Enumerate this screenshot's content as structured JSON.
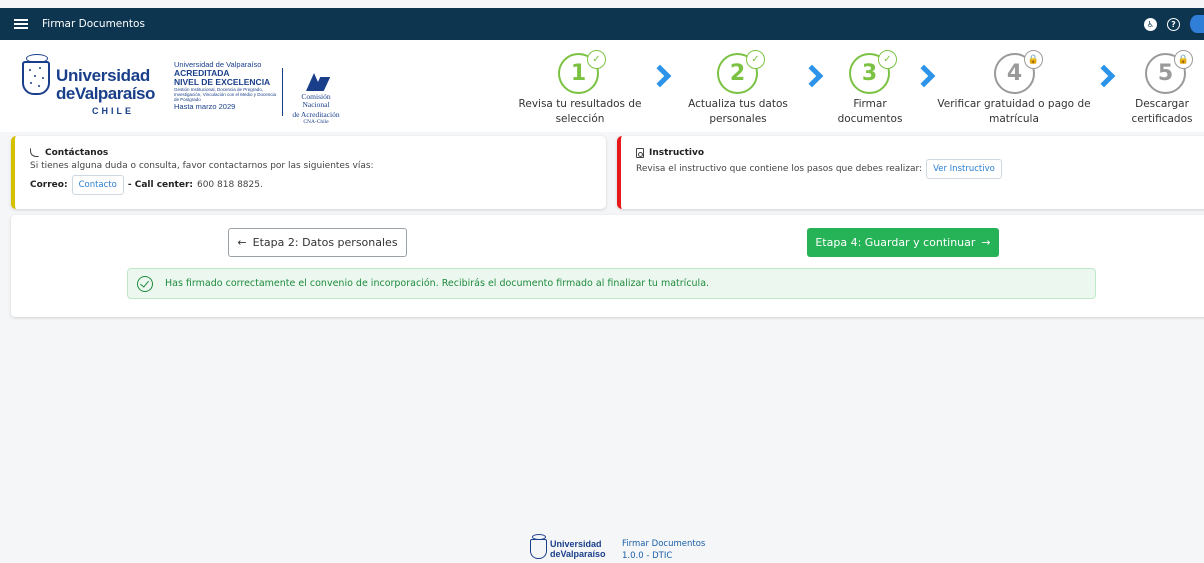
{
  "app": {
    "title": "Firmar Documentos",
    "menu_icon": "hamburger-menu-icon",
    "header_icons": [
      "accessibility-icon",
      "help-icon",
      "user-avatar-icon"
    ]
  },
  "logo": {
    "line1": "Universidad",
    "line2": "deValparaíso",
    "line3": "CHILE"
  },
  "accreditation": {
    "line1": "Universidad de Valparaíso",
    "line2": "ACREDITADA",
    "line3": "NIVEL DE EXCELENCIA",
    "details": "Gestión Institucional, Docencia de Pregrado, Investigación, Vinculación con el Medio y Docencia de Postgrado",
    "until": "Hasta marzo 2029",
    "cna_line1": "Comisión Nacional",
    "cna_line2": "de Acreditación",
    "cna_line3": "CNA-Chile"
  },
  "steps": [
    {
      "number": "1",
      "label": "Revisa tu resultados de selección",
      "status": "done"
    },
    {
      "number": "2",
      "label": "Actualiza tus datos personales",
      "status": "done"
    },
    {
      "number": "3",
      "label": "Firmar documentos",
      "status": "done"
    },
    {
      "number": "4",
      "label": "Verificar gratuidad o pago de matrícula",
      "status": "locked"
    },
    {
      "number": "5",
      "label": "Descargar certificados",
      "status": "locked"
    }
  ],
  "contact": {
    "title": "Contáctanos",
    "text": "Si tienes alguna duda o consulta, favor contactarnos por las siguientes vías:",
    "email_label": "Correo:",
    "email_button": "Contacto",
    "callcenter_label": "- Call center:",
    "callcenter_value": "600 818 8825."
  },
  "instructivo": {
    "title": "Instructivo",
    "text": "Revisa el instructivo que contiene los pasos que debes realizar:",
    "button": "Ver Instructivo"
  },
  "navigation": {
    "back_label": "Etapa 2: Datos personales",
    "next_label": "Etapa 4: Guardar y continuar"
  },
  "alert": {
    "text": "Has firmado correctamente el convenio de incorporación. Recibirás el documento firmado al finalizar tu matrícula."
  },
  "footer": {
    "line1": "Universidad",
    "line2": "deValparaíso",
    "app_name": "Firmar Documentos",
    "version": "1.0.0 - DTIC"
  },
  "colors": {
    "topbar": "#0d3550",
    "step_done": "#7cc242",
    "step_locked": "#9a9a9a",
    "arrow": "#2c93e8",
    "primary_button": "#26b256",
    "contact_accent": "#d4c000",
    "instructivo_accent": "#e8181a"
  }
}
